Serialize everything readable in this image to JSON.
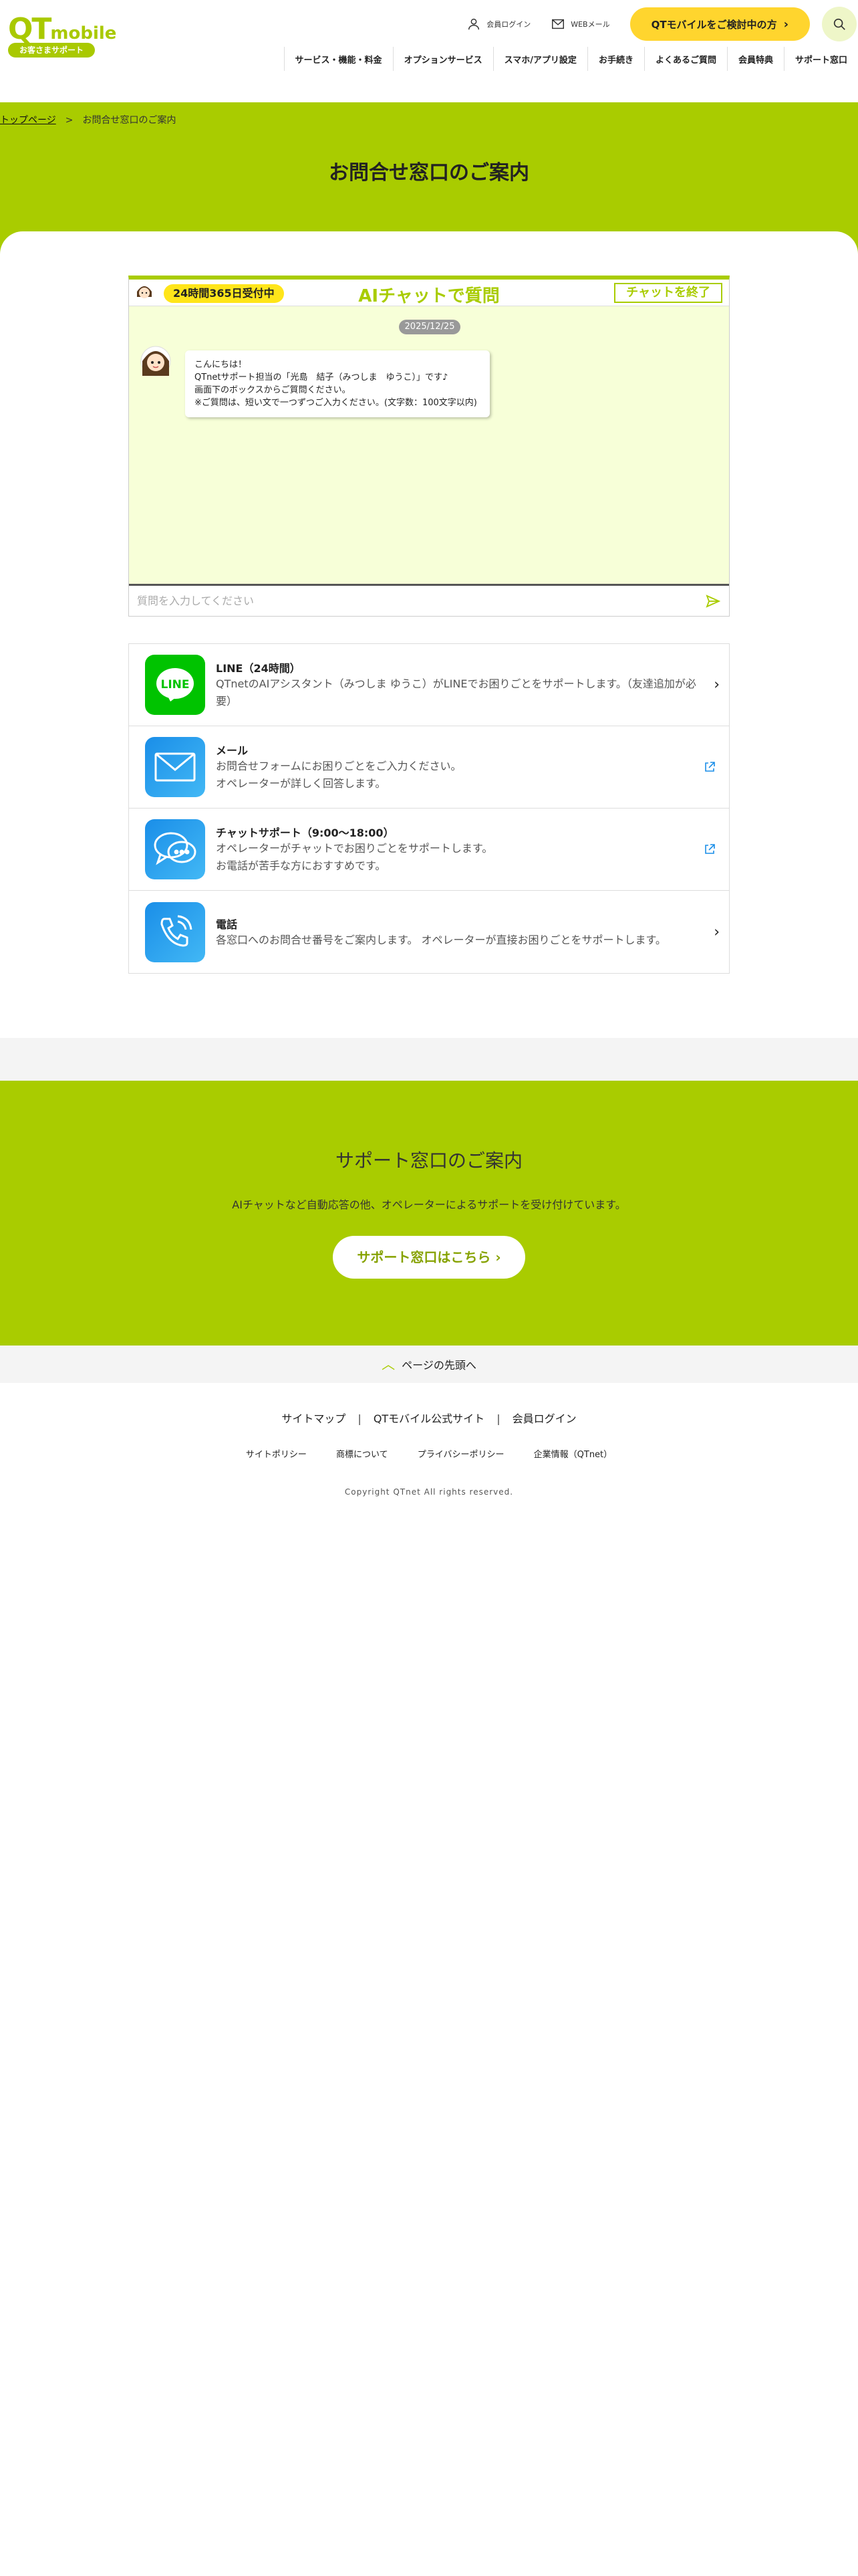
{
  "header": {
    "logo_brand": "QT",
    "logo_brand_suffix": "mobile",
    "logo_tagline": "お客さまサポート",
    "member_login": "会員ログイン",
    "web_mail": "WEBメール",
    "cta_label": "QTモバイルをご検討中の方",
    "nav": [
      "サービス・機能・料金",
      "オプションサービス",
      "スマホ/アプリ設定",
      "お手続き",
      "よくあるご質問",
      "会員特典",
      "サポート窓口"
    ]
  },
  "breadcrumb": {
    "home": "トップページ",
    "current": "お問合せ窓口のご案内"
  },
  "page_title": "お問合せ窓口のご案内",
  "chat": {
    "badge": "24時間365日受付中",
    "title": "AIチャットで質問",
    "end_button": "チャットを終了",
    "date": "2025/12/25",
    "bubble_lines": [
      "こんにちは！",
      "QTnetサポート担当の「光島　結子（みつしま　ゆうこ）」です♪",
      "画面下のボックスからご質問ください。",
      "※ご質問は、短い文で一つずつご入力ください。(文字数：100文字以内)"
    ],
    "input_placeholder": "質問を入力してください"
  },
  "contacts": [
    {
      "title": "LINE（24時間）",
      "desc": "QTnetのAIアシスタント（みつしま ゆうこ）がLINEでお困りごとをサポートします。（友達追加が必要）",
      "icon": "line-icon",
      "action": "chevron"
    },
    {
      "title": "メール",
      "desc": "お問合せフォームにお困りごとをご入力ください。",
      "desc2": "オペレーターが詳しく回答します。",
      "icon": "mail-icon",
      "action": "external"
    },
    {
      "title": "チャットサポート（9:00〜18:00）",
      "desc": "オペレーターがチャットでお困りごとをサポートします。",
      "desc2": "お電話が苦手な方におすすめです。",
      "icon": "chat-bubble-icon",
      "action": "external"
    },
    {
      "title": "電話",
      "desc": "各窓口へのお問合せ番号をご案内します。 オペレーターが直接お困りごとをサポートします。",
      "icon": "phone-icon",
      "action": "chevron"
    }
  ],
  "support": {
    "title": "サポート窓口のご案内",
    "desc": "AIチャットなど自動応答の他、オペレーターによるサポートを受け付けています。",
    "button": "サポート窓口はこちら"
  },
  "pagetop": "ページの先頭へ",
  "footer": {
    "links": [
      "サイトマップ",
      "QTモバイル公式サイト",
      "会員ログイン"
    ],
    "sub_links": [
      "サイトポリシー",
      "商標について",
      "プライバシーポリシー",
      "企業情報（QTnet）"
    ],
    "copyright": "Copyright QTnet All rights reserved."
  },
  "colors": {
    "brand_green": "#a9cc00",
    "cta_yellow": "#ffd52e",
    "line_green": "#00c300",
    "icon_blue": "#1a8ee8"
  }
}
